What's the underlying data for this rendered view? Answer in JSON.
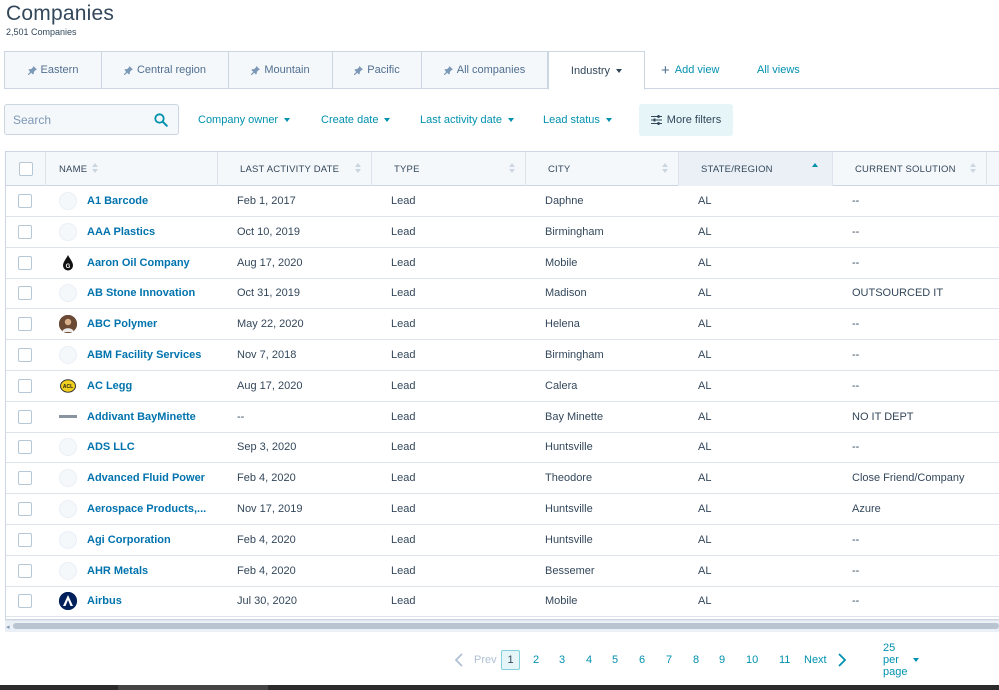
{
  "page": {
    "title": "Companies",
    "count": "2,501 Companies"
  },
  "tabs": [
    {
      "label": "Eastern",
      "pinned": true
    },
    {
      "label": "Central region",
      "pinned": true
    },
    {
      "label": "Mountain",
      "pinned": true
    },
    {
      "label": "Pacific",
      "pinned": true
    },
    {
      "label": "All companies",
      "pinned": true
    },
    {
      "label": "Industry",
      "active": true
    }
  ],
  "add_view_label": "Add view",
  "all_views_label": "All views",
  "search": {
    "placeholder": "Search"
  },
  "filters": {
    "company_owner": "Company owner",
    "create_date": "Create date",
    "last_activity_date": "Last activity date",
    "lead_status": "Lead status",
    "more_filters": "More filters"
  },
  "columns": [
    "NAME",
    "LAST ACTIVITY DATE",
    "TYPE",
    "CITY",
    "STATE/REGION",
    "CURRENT SOLUTION"
  ],
  "rows": [
    {
      "name": "A1 Barcode",
      "date": "Feb 1, 2017",
      "type": "Lead",
      "city": "Daphne",
      "state": "AL",
      "solution": "--",
      "logo": "blank"
    },
    {
      "name": "AAA Plastics",
      "date": "Oct 10, 2019",
      "type": "Lead",
      "city": "Birmingham",
      "state": "AL",
      "solution": "--",
      "logo": "blank"
    },
    {
      "name": "Aaron Oil Company",
      "date": "Aug 17, 2020",
      "type": "Lead",
      "city": "Mobile",
      "state": "AL",
      "solution": "--",
      "logo": "oil-drop"
    },
    {
      "name": "AB Stone Innovation",
      "date": "Oct 31, 2019",
      "type": "Lead",
      "city": "Madison",
      "state": "AL",
      "solution": "OUTSOURCED IT",
      "logo": "blank"
    },
    {
      "name": "ABC Polymer",
      "date": "May 22, 2020",
      "type": "Lead",
      "city": "Helena",
      "state": "AL",
      "solution": "--",
      "logo": "person-photo"
    },
    {
      "name": "ABM Facility Services",
      "date": "Nov 7, 2018",
      "type": "Lead",
      "city": "Birmingham",
      "state": "AL",
      "solution": "--",
      "logo": "blank"
    },
    {
      "name": "AC Legg",
      "date": "Aug 17, 2020",
      "type": "Lead",
      "city": "Calera",
      "state": "AL",
      "solution": "--",
      "logo": "yellow-badge"
    },
    {
      "name": "Addivant BayMinette",
      "date": "--",
      "type": "Lead",
      "city": "Bay Minette",
      "state": "AL",
      "solution": "NO IT DEPT",
      "logo": "wordmark"
    },
    {
      "name": "ADS LLC",
      "date": "Sep 3, 2020",
      "type": "Lead",
      "city": "Huntsville",
      "state": "AL",
      "solution": "--",
      "logo": "blank"
    },
    {
      "name": "Advanced Fluid Power",
      "date": "Feb 4, 2020",
      "type": "Lead",
      "city": "Theodore",
      "state": "AL",
      "solution": "Close Friend/Company",
      "logo": "blank"
    },
    {
      "name": "Aerospace Products,...",
      "date": "Nov 17, 2019",
      "type": "Lead",
      "city": "Huntsville",
      "state": "AL",
      "solution": "Azure",
      "logo": "blank"
    },
    {
      "name": "Agi Corporation",
      "date": "Feb 4, 2020",
      "type": "Lead",
      "city": "Huntsville",
      "state": "AL",
      "solution": "--",
      "logo": "blank"
    },
    {
      "name": "AHR Metals",
      "date": "Feb 4, 2020",
      "type": "Lead",
      "city": "Bessemer",
      "state": "AL",
      "solution": "--",
      "logo": "blank"
    },
    {
      "name": "Airbus",
      "date": "Jul 30, 2020",
      "type": "Lead",
      "city": "Mobile",
      "state": "AL",
      "solution": "--",
      "logo": "airbus-a"
    }
  ],
  "pagination": {
    "prev": "Prev",
    "pages": [
      "1",
      "2",
      "3",
      "4",
      "5",
      "6",
      "7",
      "8",
      "9",
      "10",
      "11"
    ],
    "current": "1",
    "next": "Next",
    "per_page": "25 per page"
  },
  "colors": {
    "link": "#0091ae",
    "name_link": "#0073ae",
    "text": "#33475b",
    "border": "#cbd6e2",
    "header_bg": "#f5f8fa"
  }
}
